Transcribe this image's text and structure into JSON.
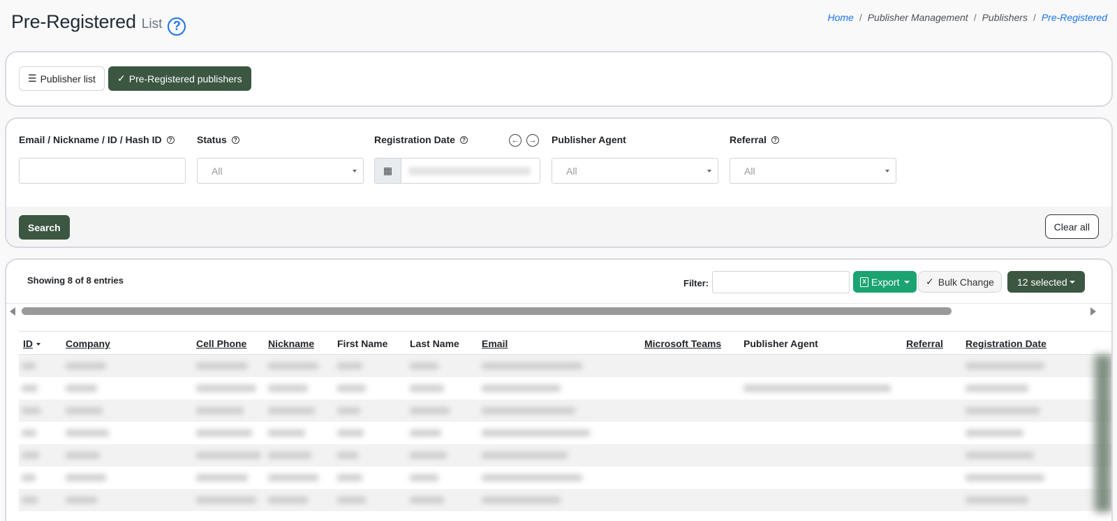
{
  "header": {
    "title": "Pre-Registered",
    "subtitle": "List",
    "help_glyph": "?"
  },
  "breadcrumb": {
    "items": [
      "Home",
      "Publisher Management",
      "Publishers",
      "Pre-Registered"
    ],
    "separator": "/"
  },
  "view_tabs": {
    "publisher_list": "Publisher list",
    "pre_registered": "Pre-Registered publishers"
  },
  "filters": {
    "email_label": "Email / Nickname / ID / Hash ID",
    "email_value": "",
    "status_label": "Status",
    "status_value": "All",
    "registration_date_label": "Registration Date",
    "publisher_agent_label": "Publisher Agent",
    "publisher_agent_value": "All",
    "referral_label": "Referral",
    "referral_value": "All",
    "search_label": "Search",
    "clear_label": "Clear all"
  },
  "table_toolbar": {
    "showing": "Showing 8 of 8 entries",
    "filter_label": "Filter:",
    "export_label": "Export",
    "bulk_change_label": "Bulk Change",
    "selected_label": "12 selected"
  },
  "table": {
    "columns": [
      "ID",
      "Company",
      "Cell Phone",
      "Nickname",
      "First Name",
      "Last Name",
      "Email",
      "Microsoft Teams",
      "Publisher Agent",
      "Referral",
      "Registration Date"
    ],
    "row_count": 7,
    "rows_blurred": true
  },
  "colors": {
    "primary_dark": "#3b5641",
    "export_green": "#1ba372",
    "link_blue": "#1a73e8"
  },
  "icons": [
    "help-circle-icon",
    "list-icon",
    "check-icon",
    "question-icon",
    "calendar-icon",
    "arrow-left-icon",
    "arrow-right-icon",
    "excel-icon",
    "chevron-down-icon"
  ]
}
